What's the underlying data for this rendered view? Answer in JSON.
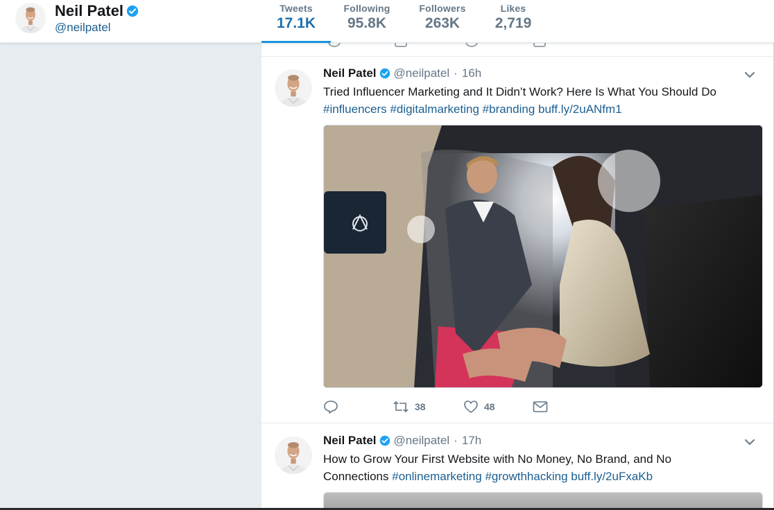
{
  "profile": {
    "name": "Neil Patel",
    "handle": "@neilpatel",
    "verified": true,
    "avatar_icon": "profile-photo-avatar"
  },
  "stats": [
    {
      "label": "Tweets",
      "value": "17.1K",
      "active": true
    },
    {
      "label": "Following",
      "value": "95.8K",
      "active": false
    },
    {
      "label": "Followers",
      "value": "263K",
      "active": false
    },
    {
      "label": "Likes",
      "value": "2,719",
      "active": false
    }
  ],
  "tweets": [
    {
      "name": "Neil Patel",
      "handle": "@neilpatel",
      "dot": "·",
      "time": "16h",
      "text": "Tried Influencer Marketing and It Didn’t Work? Here Is What You Should Do",
      "hashtags": [
        "#influencers",
        "#digitalmarketing",
        "#branding"
      ],
      "link": "buff.ly/2uANfm1",
      "media": "photo-man-helping-woman-out-of-limousine",
      "retweets": "38",
      "likes": "48"
    },
    {
      "name": "Neil Patel",
      "handle": "@neilpatel",
      "dot": "·",
      "time": "17h",
      "text_line1": "How to Grow Your First Website with No Money, No Brand, and No",
      "text_line2": "Connections",
      "hashtags": [
        "#onlinemarketing",
        "#growthhacking"
      ],
      "link": "buff.ly/2uFxaKb",
      "media": "photo-partially-visible"
    }
  ],
  "colors": {
    "accent": "#1b95e0",
    "link": "#1c5f91",
    "muted": "#657786",
    "background": "#e6ecf0"
  }
}
